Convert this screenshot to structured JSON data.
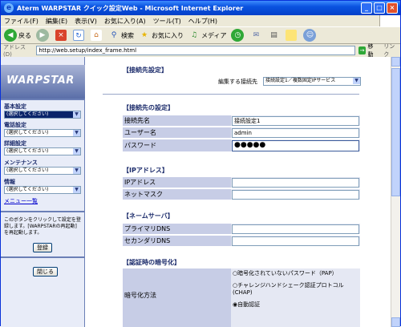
{
  "window": {
    "title": "Aterm WARPSTAR クイック設定Web - Microsoft Internet Explorer"
  },
  "menu": [
    "ファイル(F)",
    "編集(E)",
    "表示(V)",
    "お気に入り(A)",
    "ツール(T)",
    "ヘルプ(H)"
  ],
  "toolbar": {
    "back": "戻る",
    "search": "検索",
    "favorites": "お気に入り",
    "media": "メディア"
  },
  "address": {
    "label": "アドレス(D)",
    "url": "http://web.setup/index_frame.html",
    "go": "移動",
    "links": "リンク"
  },
  "sidebar": {
    "logo": "WARPSTAR",
    "groups": [
      {
        "title": "基本設定",
        "value": "(選択してください)"
      },
      {
        "title": "電話設定",
        "value": "(選択してください)"
      },
      {
        "title": "詳細設定",
        "value": "(選択してください)"
      },
      {
        "title": "メンテナンス",
        "value": "(選択してください)"
      },
      {
        "title": "情報",
        "value": "(選択してください)"
      }
    ],
    "menu_list": "メニュー一覧",
    "note": "このボタンをクリックして設定を登録します。[WARPSTARの再起動]を再起動します。",
    "register": "登録",
    "close": "閉じる"
  },
  "main": {
    "connection_title": "【接続先設定】",
    "edit_target_label": "編集する接続先",
    "edit_target_value": "接続設定1／複数固定IPサービス",
    "conn_section": "【接続先の設定】",
    "conn_rows": [
      {
        "label": "接続先名",
        "value": "接続設定1"
      },
      {
        "label": "ユーザー名",
        "value": "admin"
      },
      {
        "label": "パスワード",
        "value": "●●●●●"
      }
    ],
    "ip_section": "【IPアドレス】",
    "ip_rows": [
      {
        "label": "IPアドレス",
        "value": ""
      },
      {
        "label": "ネットマスク",
        "value": ""
      }
    ],
    "dns_section": "【ネームサーバ】",
    "dns_rows": [
      {
        "label": "プライマリDNS",
        "value": ""
      },
      {
        "label": "セカンダリDNS",
        "value": ""
      }
    ],
    "auth_section": "【認証時の暗号化】",
    "auth_label": "暗号化方法",
    "auth_options": [
      "○暗号化されていないパスワード（PAP）",
      "○チャレンジハンドシェーク認証プロトコル(CHAP)",
      "◉自動認証"
    ]
  }
}
